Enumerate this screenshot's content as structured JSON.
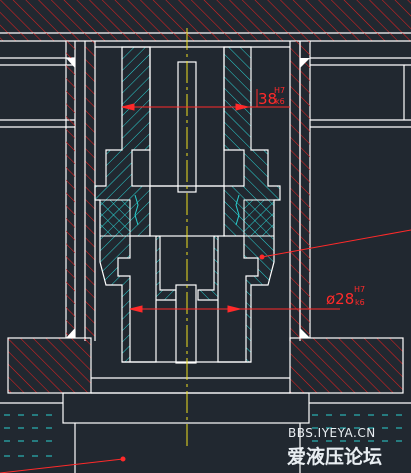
{
  "drawing": {
    "dimension_upper": {
      "value": "38",
      "fit_upper": "H7",
      "fit_lower": "k6"
    },
    "dimension_lower": {
      "value": "ø28",
      "fit_upper": "H7",
      "fit_lower": "k6"
    }
  },
  "watermark": {
    "url": "BBS.IYEYA.CN",
    "site_name": "爱液压论坛"
  },
  "colors": {
    "background": "#212830",
    "outline": "#ffffff",
    "section_hatch_red": "#e02020",
    "section_hatch_cyan": "#2ad0d0",
    "dimension": "#ff2a2a",
    "centerline": "#f0e020"
  }
}
